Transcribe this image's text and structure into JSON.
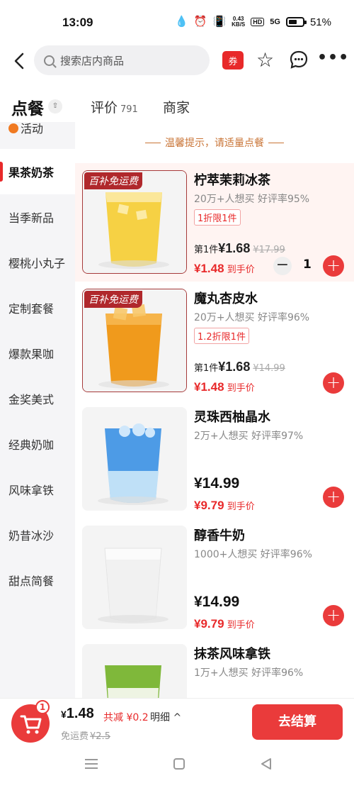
{
  "status": {
    "time": "13:09",
    "net_speed": "0.43\nKB/S",
    "hd": "HD",
    "signal": "5G",
    "battery": "51%"
  },
  "search": {
    "placeholder": "搜索店内商品"
  },
  "header": {
    "coupon_label": "券"
  },
  "tabs": [
    {
      "label": "点餐"
    },
    {
      "label": "评价",
      "count": "791"
    },
    {
      "label": "商家"
    }
  ],
  "sidebar": {
    "top_item": "活动",
    "items": [
      "果茶奶茶",
      "当季新品",
      "樱桃小丸子",
      "定制套餐",
      "爆款果咖",
      "金奖美式",
      "经典奶咖",
      "风味拿铁",
      "奶昔冰沙",
      "甜点简餐"
    ]
  },
  "tip": "温馨提示，请适量点餐",
  "products": [
    {
      "name": "柠萃茉莉冰茶",
      "meta": "20万+人想买 好评率95%",
      "ribbon": "百补免运费",
      "tag": "1折限1件",
      "first_label": "第1件",
      "first_price": "¥1.68",
      "orig": "¥17.99",
      "final": "¥1.48",
      "final_label": "到手价",
      "qty": "1",
      "color": "#f6cf3a"
    },
    {
      "name": "魔丸杏皮水",
      "meta": "20万+人想买 好评率96%",
      "ribbon": "百补免运费",
      "tag": "1.2折限1件",
      "first_label": "第1件",
      "first_price": "¥1.68",
      "orig": "¥14.99",
      "final": "¥1.48",
      "final_label": "到手价",
      "color": "#f09a1c"
    },
    {
      "name": "灵珠西柚晶水",
      "meta": "2万+人想买 好评率97%",
      "price": "¥14.99",
      "final": "¥9.79",
      "final_label": "到手价",
      "color": "#4d9be6"
    },
    {
      "name": "醇香牛奶",
      "meta": "1000+人想买 好评率96%",
      "price": "¥14.99",
      "final": "¥9.79",
      "final_label": "到手价",
      "color": "#f4f4f4"
    },
    {
      "name": "抹茶风味拿铁",
      "meta": "1万+人想买 好评率96%",
      "color": "#7fb83a"
    }
  ],
  "cart": {
    "badge": "1",
    "total_sym": "¥",
    "total": "1.48",
    "discount": "共减 ¥0.2",
    "detail": "明细 ^",
    "free": "免运费",
    "free_orig": "¥2.5",
    "checkout": "去结算"
  },
  "icons": {
    "back": "back-arrow-icon",
    "search": "search-icon",
    "star": "star-icon",
    "chat": "chat-icon",
    "more": "more-icon",
    "cart": "cart-icon",
    "add": "plus-icon",
    "minus": "minus-icon"
  },
  "colors": {
    "accent": "#ea3b3b",
    "tip": "#c97436",
    "sidebar_bg": "#f5f5f7"
  }
}
